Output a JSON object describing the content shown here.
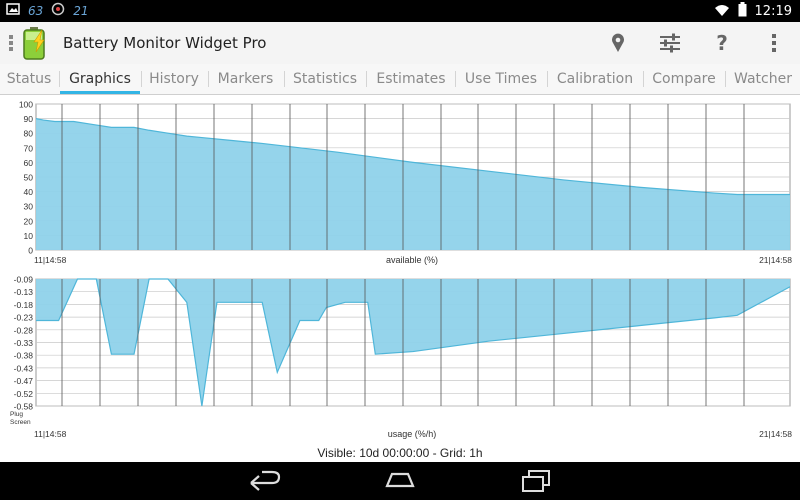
{
  "status_bar": {
    "time": "12:19",
    "left_icons": [
      "photo-icon",
      "notification-63-icon",
      "camera-icon",
      "notification-21-icon"
    ],
    "right_icons": [
      "wifi-icon",
      "battery-icon"
    ],
    "left_texts": [
      "63",
      "21"
    ]
  },
  "app": {
    "title": "Battery Monitor Widget Pro",
    "actions": [
      "location-icon",
      "settings-sliders-icon",
      "help-icon",
      "overflow-menu-icon"
    ],
    "help_label": "?"
  },
  "tabs": [
    "Status",
    "Graphics",
    "History",
    "Markers",
    "Statistics",
    "Estimates",
    "Use Times",
    "Calibration",
    "Compare",
    "Watcher"
  ],
  "active_tab": "Graphics",
  "colors": {
    "accent": "#33b5e5",
    "fill": "#8fd2ea",
    "line": "#4fb6d9",
    "grid": "#c8c8c8"
  },
  "chart_data": [
    {
      "type": "area",
      "title": "available (%)",
      "x_start_label": "11|14:58",
      "x_end_label": "21|14:58",
      "ylim": [
        0,
        100
      ],
      "yticks": [
        "100",
        "90",
        "80",
        "70",
        "60",
        "50",
        "40",
        "30",
        "20",
        "10",
        "0"
      ],
      "x_days": [
        0,
        0.1,
        0.25,
        0.5,
        0.75,
        1.0,
        1.3,
        1.5,
        1.75,
        2.0,
        2.2,
        2.6,
        3.0,
        3.5,
        4.0,
        5.0,
        6.0,
        7.0,
        8.0,
        9.0,
        9.3,
        9.6,
        10.0
      ],
      "values": [
        90,
        89,
        88,
        88,
        86,
        84,
        84,
        82,
        80,
        78,
        77,
        75,
        73,
        70,
        67,
        60,
        54,
        48,
        43,
        39,
        38,
        38,
        38
      ],
      "grid": true
    },
    {
      "type": "area",
      "title": "usage (%/h)",
      "x_start_label": "11|14:58",
      "x_end_label": "21|14:58",
      "ylim": [
        -0.58,
        -0.09
      ],
      "yticks": [
        "-0.09",
        "-0.13",
        "-0.18",
        "-0.23",
        "-0.28",
        "-0.33",
        "-0.38",
        "-0.43",
        "-0.47",
        "-0.52",
        "-0.58"
      ],
      "row_labels": [
        "Plug",
        "Screen"
      ],
      "x_days": [
        0,
        0.3,
        0.55,
        0.8,
        1.0,
        1.3,
        1.5,
        1.6,
        1.65,
        1.75,
        2.0,
        2.2,
        2.4,
        2.45,
        2.6,
        2.8,
        3.0,
        3.2,
        3.5,
        3.75,
        3.85,
        4.1,
        4.4,
        4.5,
        5.0,
        6.0,
        7.0,
        8.0,
        9.0,
        9.3,
        10.0
      ],
      "values": [
        -0.25,
        -0.25,
        -0.09,
        -0.09,
        -0.38,
        -0.38,
        -0.09,
        -0.09,
        -0.09,
        -0.09,
        -0.18,
        -0.58,
        -0.18,
        -0.18,
        -0.18,
        -0.18,
        -0.18,
        -0.45,
        -0.25,
        -0.25,
        -0.2,
        -0.18,
        -0.18,
        -0.38,
        -0.37,
        -0.33,
        -0.3,
        -0.27,
        -0.24,
        -0.23,
        -0.12
      ],
      "grid": true
    }
  ],
  "footer": "Visible: 10d 00:00:00 - Grid: 1h",
  "nav_buttons": [
    "back-icon",
    "home-icon",
    "recent-apps-icon"
  ]
}
